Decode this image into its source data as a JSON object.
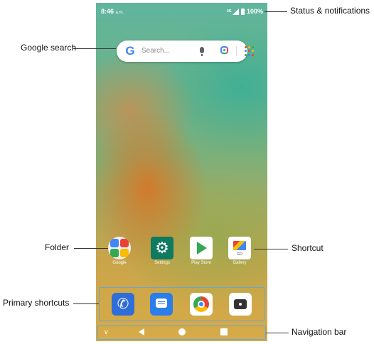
{
  "status_bar": {
    "time": "8:46",
    "time_suffix": "a.m.",
    "battery": "100%"
  },
  "search": {
    "placeholder": "Search..."
  },
  "apps": [
    {
      "label": "Google"
    },
    {
      "label": "Settings"
    },
    {
      "label": "Play Store"
    },
    {
      "label": "Gallery"
    }
  ],
  "gallery_badge": "GO",
  "dock": [
    "phone",
    "messages",
    "chrome",
    "camera"
  ],
  "callouts": {
    "status": "Status & notifications",
    "search": "Google search",
    "folder": "Folder",
    "shortcut": "Shortcut",
    "primary": "Primary shortcuts",
    "navbar": "Navigation bar"
  },
  "colors": {
    "annotation_frame": "#6aa5d8",
    "settings_icon_bg": "#0e7a5f",
    "phone_icon_bg": "#2f6ed8"
  },
  "icons": {
    "search": "google-g-icon",
    "mic": "mic-icon",
    "lens": "lens-icon",
    "apps": "apps-grid-icon",
    "back": "back-triangle-icon",
    "home": "home-circle-icon",
    "recent": "recents-square-icon",
    "chevron": "chevron-down-icon"
  }
}
